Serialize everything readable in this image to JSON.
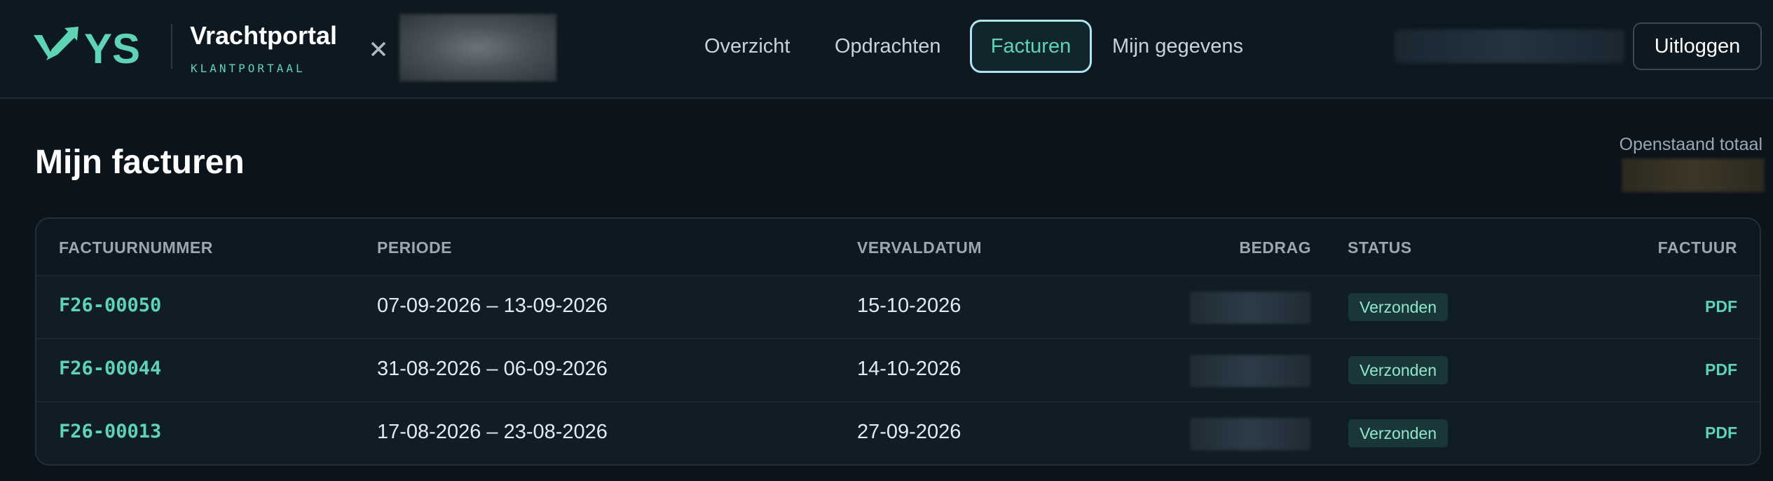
{
  "header": {
    "brand_title": "Vrachtportal",
    "brand_subtitle": "KLANTPORTAAL",
    "logo_text": "YS",
    "nav": [
      {
        "label": "Overzicht",
        "active": false
      },
      {
        "label": "Opdrachten",
        "active": false
      },
      {
        "label": "Facturen",
        "active": true
      },
      {
        "label": "Mijn gegevens",
        "active": false
      }
    ],
    "logout_label": "Uitloggen"
  },
  "page": {
    "title": "Mijn facturen",
    "outstanding_label": "Openstaand totaal"
  },
  "table": {
    "columns": [
      "FACTUURNUMMER",
      "PERIODE",
      "VERVALDATUM",
      "BEDRAG",
      "STATUS",
      "FACTUUR"
    ],
    "rows": [
      {
        "number": "F26-00050",
        "period": "07-09-2026 – 13-09-2026",
        "due": "15-10-2026",
        "status": "Verzonden",
        "invoice": "PDF"
      },
      {
        "number": "F26-00044",
        "period": "31-08-2026 – 06-09-2026",
        "due": "14-10-2026",
        "status": "Verzonden",
        "invoice": "PDF"
      },
      {
        "number": "F26-00013",
        "period": "17-08-2026 – 23-08-2026",
        "due": "27-09-2026",
        "status": "Verzonden",
        "invoice": "PDF"
      }
    ]
  },
  "colors": {
    "accent": "#5ed3b6",
    "background": "#0b131b",
    "active_border": "#aee3ef"
  },
  "icons": {
    "brand": "arrow-logo-icon",
    "close": "close-icon"
  }
}
